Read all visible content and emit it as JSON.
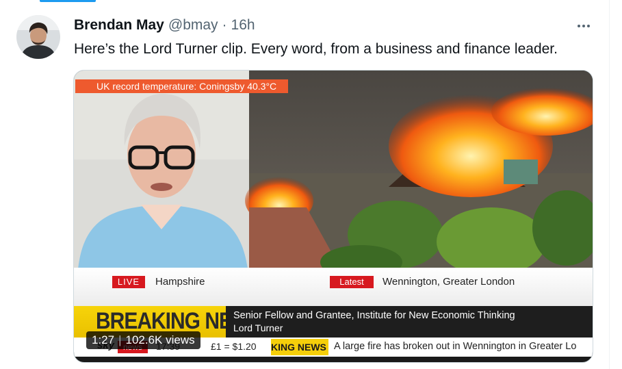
{
  "tweet": {
    "author_name": "Brendan May",
    "handle": "@bmay",
    "separator": "·",
    "timestamp": "16h",
    "more_icon": "more-horizontal-icon",
    "text": "Here’s the Lord Turner clip. Every word, from a business and finance leader."
  },
  "video": {
    "temp_banner": "UK record temperature: Coningsby 40.3°C",
    "live_label": "LIVE",
    "live_location": "Hampshire",
    "latest_label": "Latest",
    "latest_location": "Wennington, Greater London",
    "breaking_label": "BREAKING NEWS",
    "guest_title": "Senior Fellow and Grantee, Institute for New Economic Thinking",
    "guest_name": "Lord Turner",
    "sky_logo": "sky",
    "sky_news": "news",
    "clock": "17:39",
    "fx_rate": "£1 = $1.20",
    "breaking_short": "KING NEWS",
    "scroll_text": "A large fire has broken out in Wennington in Greater Lo",
    "duration": "1:27",
    "views": "102.6K views"
  },
  "colors": {
    "accent": "#1d9bf0",
    "banner_orange": "#ee5a2e",
    "live_red": "#d7191f",
    "breaking_yellow": "#f5cf0a"
  }
}
